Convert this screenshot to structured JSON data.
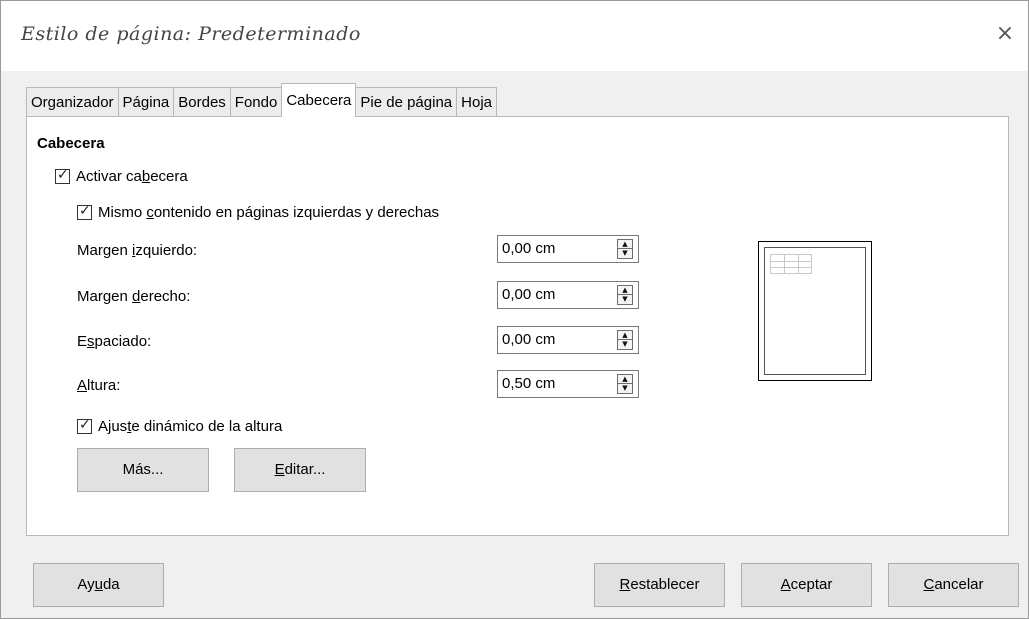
{
  "window": {
    "title": "Estilo de página: Predeterminado",
    "close_label": "×"
  },
  "tabs": [
    {
      "label": "Organizador",
      "active": false
    },
    {
      "label": "Página",
      "active": false
    },
    {
      "label": "Bordes",
      "active": false
    },
    {
      "label": "Fondo",
      "active": false
    },
    {
      "label": "Cabecera",
      "active": true
    },
    {
      "label": "Pie de página",
      "active": false
    },
    {
      "label": "Hoja",
      "active": false
    }
  ],
  "section": {
    "title": "Cabecera"
  },
  "options": {
    "enable_header": {
      "pre": "Activar ca",
      "u": "b",
      "post": "ecera",
      "checked": true
    },
    "same_content": {
      "pre": "Mismo ",
      "u": "c",
      "post": "ontenido en páginas izquierdas y derechas",
      "checked": true
    },
    "dynamic_height": {
      "pre": "Ajus",
      "u": "t",
      "post": "e dinámico de la altura",
      "checked": true
    }
  },
  "fields": {
    "left_margin": {
      "pre": "Margen ",
      "u": "i",
      "post": "zquierdo:",
      "value": "0,00 cm"
    },
    "right_margin": {
      "pre": "Margen ",
      "u": "d",
      "post": "erecho:",
      "value": "0,00 cm"
    },
    "spacing": {
      "pre": "E",
      "u": "s",
      "post": "paciado:",
      "value": "0,00 cm"
    },
    "height": {
      "pre": "",
      "u": "A",
      "post": "ltura:",
      "value": "0,50 cm"
    }
  },
  "buttons": {
    "more": {
      "pre": "Más...",
      "u": "",
      "post": ""
    },
    "edit": {
      "pre": "",
      "u": "E",
      "post": "ditar..."
    },
    "help": {
      "pre": "Ay",
      "u": "u",
      "post": "da"
    },
    "reset": {
      "pre": "",
      "u": "R",
      "post": "establecer"
    },
    "ok": {
      "pre": "",
      "u": "A",
      "post": "ceptar"
    },
    "cancel": {
      "pre": "",
      "u": "C",
      "post": "ancelar"
    }
  },
  "icons": {
    "checkmark": "checkmark-icon",
    "spin_up": "up-arrow-icon",
    "spin_down": "down-arrow-icon"
  },
  "colors": {
    "dialog_bg": "#f0f0f0",
    "panel_bg": "#ffffff",
    "button_bg": "#e1e1e1"
  }
}
